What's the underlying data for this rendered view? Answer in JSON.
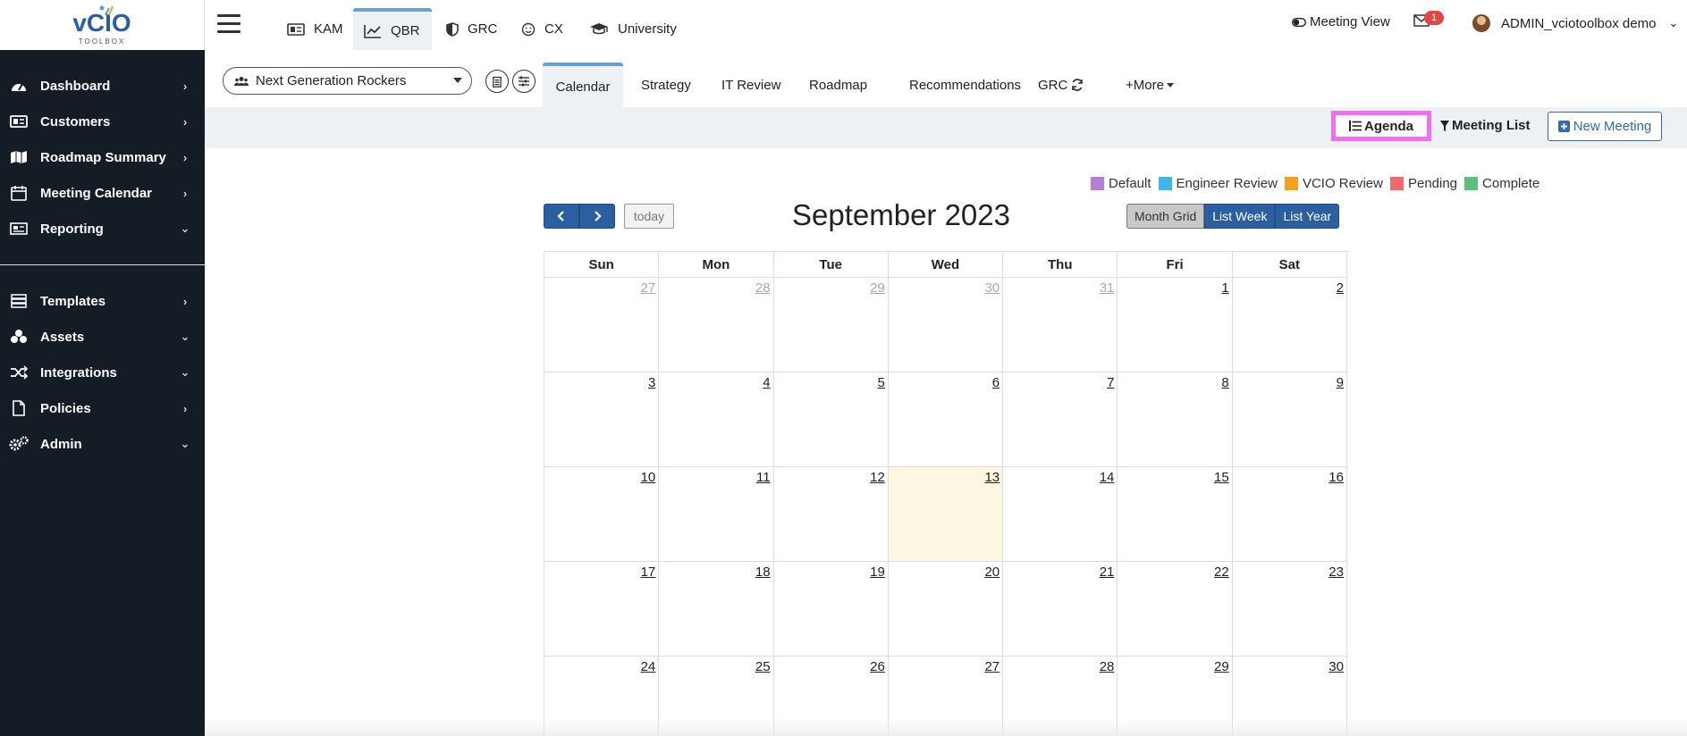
{
  "logo": {
    "text_main": "vCIO",
    "text_sub": "TOOLBOX"
  },
  "sidebar": {
    "items": [
      {
        "label": "Dashboard",
        "icon": "gauge-icon",
        "chevron": "right"
      },
      {
        "label": "Customers",
        "icon": "id-card-icon",
        "chevron": "right"
      },
      {
        "label": "Roadmap Summary",
        "icon": "map-icon",
        "chevron": "right"
      },
      {
        "label": "Meeting Calendar",
        "icon": "calendar-icon",
        "chevron": "right"
      },
      {
        "label": "Reporting",
        "icon": "newspaper-icon",
        "chevron": "down"
      },
      {
        "label": "Templates",
        "icon": "layers-icon",
        "chevron": "right"
      },
      {
        "label": "Assets",
        "icon": "cubes-icon",
        "chevron": "down"
      },
      {
        "label": "Integrations",
        "icon": "shuffle-icon",
        "chevron": "down"
      },
      {
        "label": "Policies",
        "icon": "file-icon",
        "chevron": "right"
      },
      {
        "label": "Admin",
        "icon": "gears-icon",
        "chevron": "down"
      }
    ]
  },
  "topbar": {
    "tabs": [
      {
        "label": "KAM",
        "icon": "id-card-icon"
      },
      {
        "label": "QBR",
        "icon": "line-chart-icon",
        "active": true
      },
      {
        "label": "GRC",
        "icon": "shield-icon"
      },
      {
        "label": "CX",
        "icon": "smile-icon"
      },
      {
        "label": "University",
        "icon": "graduation-cap-icon"
      }
    ],
    "meeting_view": "Meeting View",
    "mail_badge": "1",
    "user_name": "ADMIN_vciotoolbox demo"
  },
  "subbar": {
    "customer": "Next Generation Rockers",
    "tabs": [
      {
        "label": "Calendar",
        "active": true
      },
      {
        "label": "Strategy"
      },
      {
        "label": "IT Review"
      },
      {
        "label": "Roadmap"
      },
      {
        "label": "Recommendations"
      },
      {
        "label": "GRC"
      },
      {
        "label": "+More"
      }
    ]
  },
  "actions": {
    "agenda": "Agenda",
    "meeting_list": "Meeting List",
    "new_meeting": "New Meeting"
  },
  "legend": [
    {
      "label": "Default",
      "color": "#b57cd8"
    },
    {
      "label": "Engineer Review",
      "color": "#3fb7e6"
    },
    {
      "label": "VCIO Review",
      "color": "#f5a21b"
    },
    {
      "label": "Pending",
      "color": "#f06a6a"
    },
    {
      "label": "Complete",
      "color": "#5cbf7d"
    }
  ],
  "calendar": {
    "title": "September 2023",
    "today_label": "today",
    "views": [
      "Month Grid",
      "List Week",
      "List Year"
    ],
    "active_view": "Month Grid",
    "days_of_week": [
      "Sun",
      "Mon",
      "Tue",
      "Wed",
      "Thu",
      "Fri",
      "Sat"
    ],
    "today_date": "13",
    "weeks": [
      [
        {
          "d": "27",
          "other": true
        },
        {
          "d": "28",
          "other": true
        },
        {
          "d": "29",
          "other": true
        },
        {
          "d": "30",
          "other": true
        },
        {
          "d": "31",
          "other": true
        },
        {
          "d": "1"
        },
        {
          "d": "2"
        }
      ],
      [
        {
          "d": "3"
        },
        {
          "d": "4"
        },
        {
          "d": "5"
        },
        {
          "d": "6"
        },
        {
          "d": "7"
        },
        {
          "d": "8"
        },
        {
          "d": "9"
        }
      ],
      [
        {
          "d": "10"
        },
        {
          "d": "11"
        },
        {
          "d": "12"
        },
        {
          "d": "13",
          "today": true
        },
        {
          "d": "14"
        },
        {
          "d": "15"
        },
        {
          "d": "16"
        }
      ],
      [
        {
          "d": "17"
        },
        {
          "d": "18"
        },
        {
          "d": "19"
        },
        {
          "d": "20"
        },
        {
          "d": "21"
        },
        {
          "d": "22"
        },
        {
          "d": "23"
        }
      ],
      [
        {
          "d": "24"
        },
        {
          "d": "25"
        },
        {
          "d": "26"
        },
        {
          "d": "27"
        },
        {
          "d": "28"
        },
        {
          "d": "29"
        },
        {
          "d": "30"
        }
      ]
    ]
  }
}
